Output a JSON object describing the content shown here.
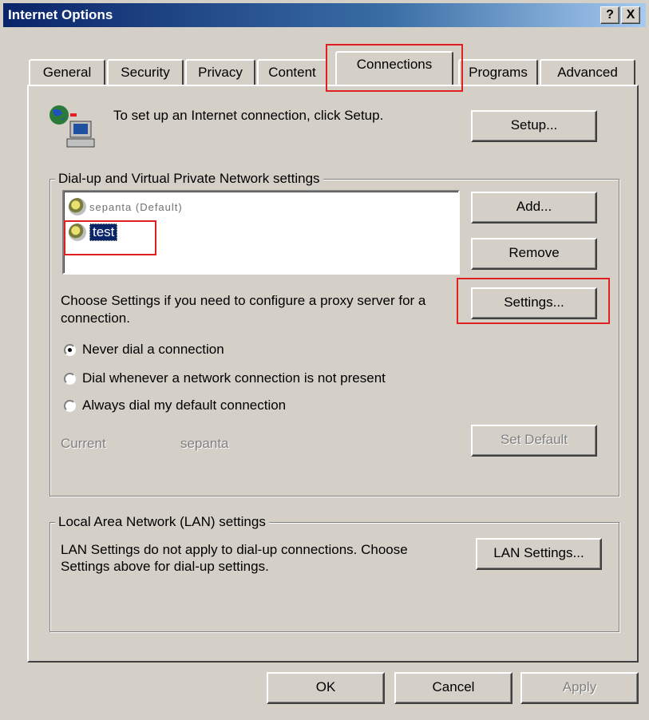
{
  "window": {
    "title": "Internet Options",
    "help_button": "?",
    "close_button": "X"
  },
  "tabs": [
    {
      "label": "General"
    },
    {
      "label": "Security"
    },
    {
      "label": "Privacy"
    },
    {
      "label": "Content"
    },
    {
      "label": "Connections"
    },
    {
      "label": "Programs"
    },
    {
      "label": "Advanced"
    }
  ],
  "setup": {
    "text": "To set up an Internet connection, click Setup.",
    "button": "Setup..."
  },
  "dialup": {
    "legend": "Dial-up and Virtual Private Network settings",
    "items": [
      {
        "label": "sepanta (Default)"
      },
      {
        "label": "test"
      }
    ],
    "add_button": "Add...",
    "remove_button": "Remove",
    "proxy_text": "Choose Settings if you need to configure a proxy server for a connection.",
    "settings_button": "Settings...",
    "options": [
      {
        "label": "Never dial a connection",
        "selected": true
      },
      {
        "label": "Dial whenever a network connection is not present",
        "selected": false
      },
      {
        "label": "Always dial my default connection",
        "selected": false
      }
    ],
    "current_label": "Current",
    "current_value": "sepanta",
    "set_default_button": "Set Default"
  },
  "lan": {
    "legend": "Local Area Network (LAN) settings",
    "text": "LAN Settings do not apply to dial-up connections. Choose Settings above for dial-up settings.",
    "button": "LAN Settings..."
  },
  "footer": {
    "ok": "OK",
    "cancel": "Cancel",
    "apply": "Apply"
  },
  "colors": {
    "face": "#d4d0c8",
    "title_start": "#0a246a",
    "highlight_box": "#e02020"
  }
}
